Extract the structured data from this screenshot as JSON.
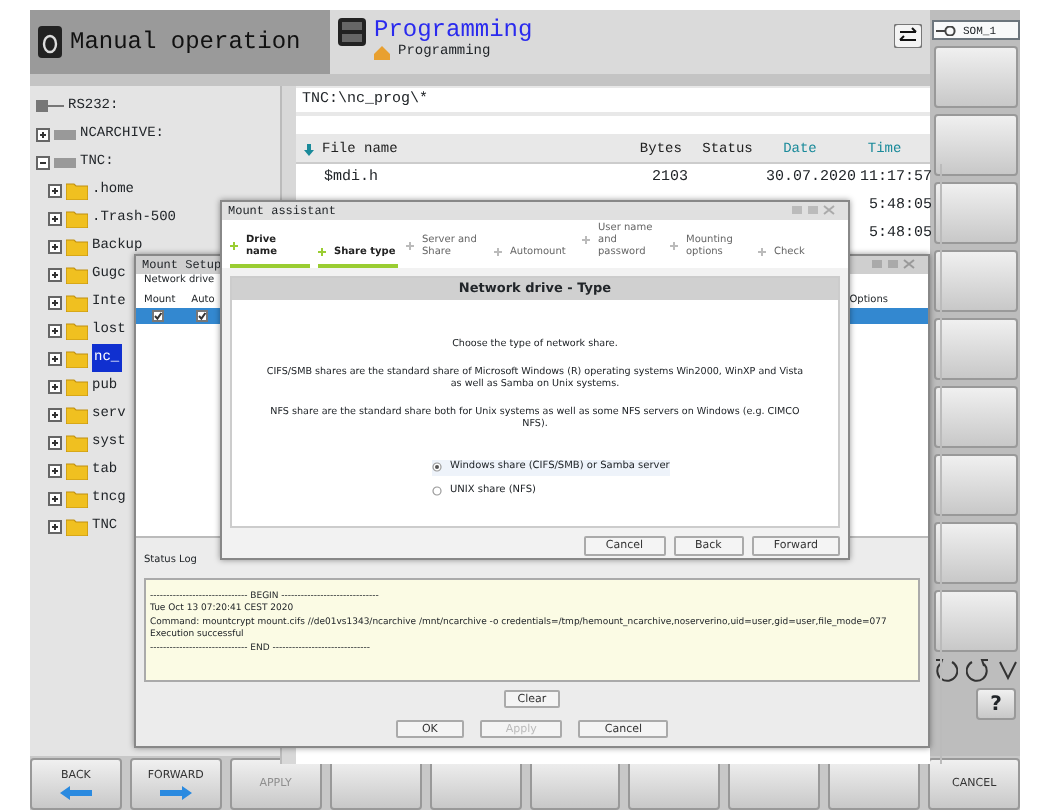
{
  "header": {
    "mode": "Manual operation",
    "program_title": "Programming",
    "program_subtitle": "Programming",
    "som_key": "SOM_1"
  },
  "tree": [
    {
      "label": "RS232:",
      "kind": "serial",
      "selected": false
    },
    {
      "label": "NCARCHIVE:",
      "kind": "drive",
      "expanded": false,
      "selected": false
    },
    {
      "label": "TNC:",
      "kind": "drive",
      "expanded": true,
      "selected": false,
      "children": [
        {
          "label": ".home",
          "kind": "folder",
          "expanded": false,
          "selected": false
        },
        {
          "label": ".Trash-500",
          "kind": "folder",
          "expanded": false,
          "selected": false
        },
        {
          "label": "Backup",
          "kind": "folder",
          "expanded": false,
          "selected": false
        },
        {
          "label": "Gugc",
          "kind": "folder",
          "expanded": false,
          "selected": false
        },
        {
          "label": "Inte",
          "kind": "folder",
          "expanded": false,
          "selected": false
        },
        {
          "label": "lost",
          "kind": "folder",
          "expanded": false,
          "selected": false
        },
        {
          "label": "nc_",
          "kind": "folder",
          "expanded": false,
          "selected": true
        },
        {
          "label": "pub",
          "kind": "folder",
          "expanded": false,
          "selected": false
        },
        {
          "label": "serv",
          "kind": "folder",
          "expanded": false,
          "selected": false
        },
        {
          "label": "syst",
          "kind": "folder",
          "expanded": false,
          "selected": false
        },
        {
          "label": "tab",
          "kind": "folder",
          "expanded": false,
          "selected": false
        },
        {
          "label": "tncg",
          "kind": "folder",
          "expanded": false,
          "selected": false
        },
        {
          "label": "TNC",
          "kind": "folder",
          "expanded": false,
          "selected": false
        }
      ]
    }
  ],
  "file_panel": {
    "path": "TNC:\\nc_prog\\*",
    "columns": [
      {
        "label": "File name",
        "sorted": true,
        "color": "#222222"
      },
      {
        "label": "Bytes",
        "sorted": false,
        "color": "#222222"
      },
      {
        "label": "Status",
        "sorted": false,
        "color": "#222222"
      },
      {
        "label": "Date",
        "sorted": false,
        "color": "#1a8a9a"
      },
      {
        "label": "Time",
        "sorted": false,
        "color": "#1a8a9a"
      }
    ],
    "rows": [
      {
        "file_name": "$mdi.h",
        "bytes": "2103",
        "date": "30.07.2020",
        "time": "11:17:57"
      },
      {
        "time": "5:48:05"
      },
      {
        "time": "5:48:05"
      }
    ]
  },
  "mount_setup": {
    "title": "Mount Setup",
    "section": "Network drive",
    "columns": [
      "Mount",
      "Auto",
      "Options"
    ],
    "rows": [
      {
        "selected": true,
        "mount": true,
        "auto": true
      }
    ],
    "status_log": {
      "label": "Status Log",
      "lines": [
        "------------------------------ BEGIN ------------------------------",
        "Tue Oct 13 07:20:41 CEST 2020",
        "Command: mountcrypt mount.cifs  //de01vs1343/ncarchive /mnt/ncarchive -o credentials=/tmp/hemount_ncarchive,noserverino,uid=user,gid=user,file_mode=077",
        "Execution successful",
        "------------------------------ END ------------------------------"
      ]
    },
    "clear_button": "Clear",
    "buttons": [
      {
        "label": "OK",
        "disabled": false
      },
      {
        "label": "Apply",
        "disabled": true
      },
      {
        "label": "Cancel",
        "disabled": false
      }
    ]
  },
  "mount_assistant": {
    "title": "Mount assistant",
    "steps": [
      {
        "label": "Drive name",
        "done": true
      },
      {
        "label": "Share type",
        "done": true
      },
      {
        "label": "Server and Share",
        "done": false
      },
      {
        "label": "Automount",
        "done": false
      },
      {
        "label": "User name and password",
        "done": false
      },
      {
        "label": "Mounting options",
        "done": false
      },
      {
        "label": "Check",
        "done": false
      }
    ],
    "heading": "Network drive - Type",
    "paragraphs": [
      "Choose the type of network share.",
      "CIFS/SMB shares are the standard share of Microsoft Windows (R) operating systems Win2000, WinXP and Vista as well as Samba on Unix systems.",
      "NFS share are the standard share both for Unix systems as well as some NFS servers on Windows (e.g. CIMCO NFS)."
    ],
    "options": [
      {
        "label": "Windows share (CIFS/SMB) or Samba server",
        "selected": true
      },
      {
        "label": "UNIX share (NFS)",
        "selected": false
      }
    ],
    "buttons": [
      "Cancel",
      "Back",
      "Forward"
    ]
  },
  "side_softkeys": [
    {
      "kind": "blank"
    },
    {
      "kind": "blank"
    },
    {
      "kind": "blank"
    },
    {
      "kind": "blank"
    },
    {
      "kind": "blank"
    },
    {
      "kind": "blank"
    },
    {
      "kind": "blank"
    },
    {
      "kind": "blank"
    },
    {
      "kind": "blank"
    }
  ],
  "help_key": "?",
  "softkeys": [
    {
      "kind": "back",
      "label": "BACK",
      "disabled": false
    },
    {
      "kind": "forward",
      "label": "FORWARD",
      "disabled": false
    },
    {
      "kind": "text",
      "label": "APPLY",
      "disabled": true
    },
    {
      "kind": "blank"
    },
    {
      "kind": "blank"
    },
    {
      "kind": "blank"
    },
    {
      "kind": "blank"
    },
    {
      "kind": "blank"
    },
    {
      "kind": "blank"
    },
    {
      "kind": "text",
      "label": "CANCEL",
      "disabled": false
    }
  ]
}
